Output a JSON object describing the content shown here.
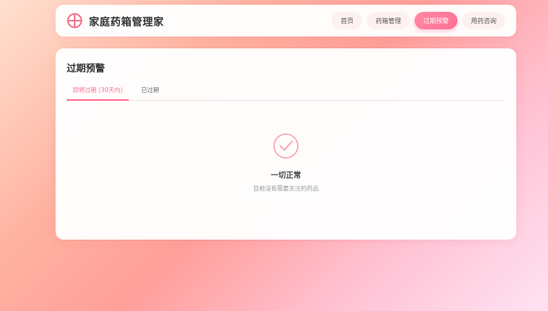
{
  "app": {
    "title": "家庭药箱管理家",
    "logo_icon": "cross-circle-icon",
    "accent_color": "#ff6f94"
  },
  "nav": {
    "items": [
      {
        "label": "首页",
        "active": false
      },
      {
        "label": "药箱管理",
        "active": false
      },
      {
        "label": "过期预警",
        "active": true
      },
      {
        "label": "用药咨询",
        "active": false
      }
    ]
  },
  "main": {
    "title": "过期预警",
    "tabs": [
      {
        "label": "即将过期 (30天内)",
        "active": true
      },
      {
        "label": "已过期",
        "active": false
      }
    ],
    "empty_state": {
      "icon": "check-circle-icon",
      "title": "一切正常",
      "description": "目前没有需要关注的药品"
    }
  }
}
